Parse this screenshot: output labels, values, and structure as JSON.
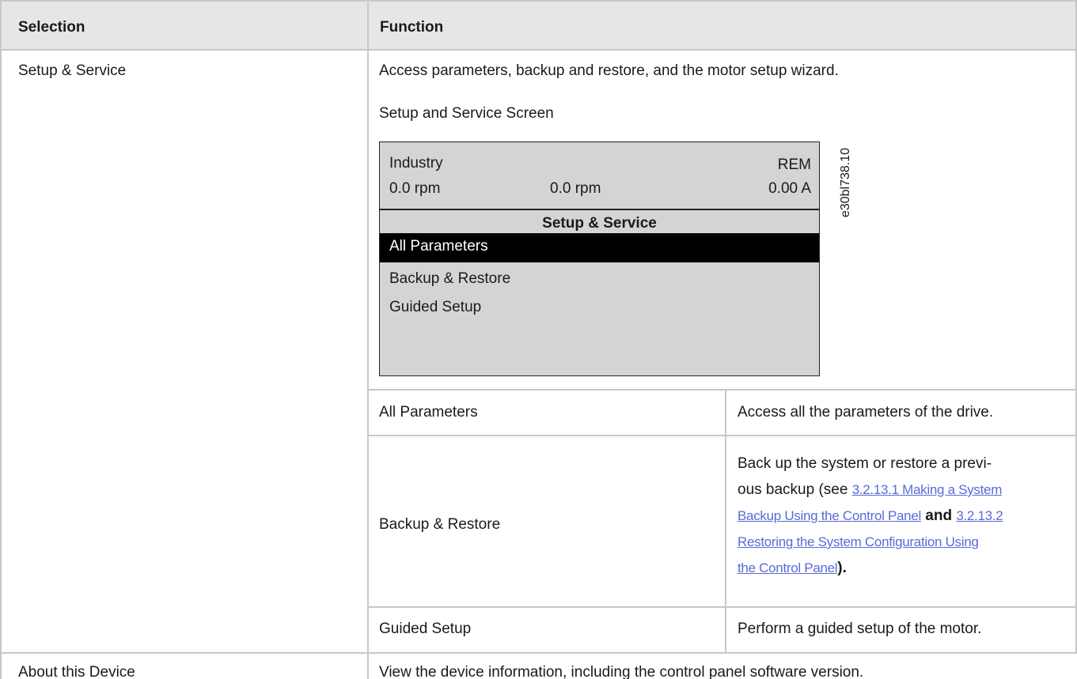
{
  "headers": {
    "selection": "Selection",
    "function": "Function"
  },
  "rows": {
    "setup": {
      "selection": "Setup & Service",
      "description": "Access parameters, backup and restore, and the motor setup wizard.",
      "caption": "Setup and Service Screen"
    },
    "about": {
      "selection": "About this Device",
      "description": "View the device information, including the control panel software version."
    }
  },
  "screen": {
    "mode": "Industry",
    "status": "REM",
    "speed_left": "0.0 rpm",
    "speed_mid": "0.0 rpm",
    "current": "0.00 A",
    "title": "Setup & Service",
    "menu": [
      "All Parameters",
      "Backup & Restore",
      "Guided Setup"
    ],
    "figure_code": "e30bl738.10"
  },
  "subtable": [
    {
      "name": "All Parameters",
      "desc": "Access all the parameters of the drive."
    },
    {
      "name": "Backup & Restore"
    },
    {
      "name": "Guided Setup",
      "desc": "Perform a guided setup of the motor."
    }
  ],
  "backup_desc": {
    "line1": "Back up the system or restore a previ-",
    "line2_pre": "ous backup (see ",
    "link1_part1": "3.2.13.1 Making a System",
    "link1_part2": "Backup Using the Control Panel",
    "and": "and",
    "link2_part1": "3.2.13.2",
    "link2_part2": "Restoring the System Configuration Using",
    "link2_part3": "the Control Panel",
    "end": ")."
  }
}
